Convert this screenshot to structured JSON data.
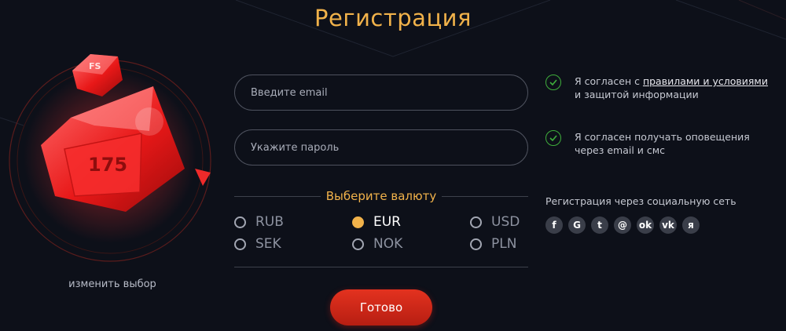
{
  "header": {
    "title": "Регистрация"
  },
  "bonus": {
    "badge": "FS",
    "value": "175",
    "change_label": "изменить выбор"
  },
  "form": {
    "email_placeholder": "Введите email",
    "password_placeholder": "Укажите пароль",
    "currency_title": "Выберите валюту",
    "currencies": [
      {
        "code": "RUB",
        "selected": false
      },
      {
        "code": "EUR",
        "selected": true
      },
      {
        "code": "USD",
        "selected": false
      },
      {
        "code": "SEK",
        "selected": false
      },
      {
        "code": "NOK",
        "selected": false
      },
      {
        "code": "PLN",
        "selected": false
      }
    ],
    "submit_label": "Готово"
  },
  "agreements": {
    "rules_prefix": "Я согласен с ",
    "rules_link": "правилами и условиями",
    "rules_suffix": "и защитой информации",
    "notify_line1": "Я согласен получать оповещения",
    "notify_line2": "через email и смс"
  },
  "social": {
    "title": "Регистрация через социальную сеть",
    "networks": [
      {
        "icon": "facebook-icon",
        "glyph": "f"
      },
      {
        "icon": "google-icon",
        "glyph": "G"
      },
      {
        "icon": "twitter-icon",
        "glyph": "t"
      },
      {
        "icon": "mailru-icon",
        "glyph": "@"
      },
      {
        "icon": "odnoklassniki-icon",
        "glyph": "ok"
      },
      {
        "icon": "vk-icon",
        "glyph": "vk"
      },
      {
        "icon": "yandex-icon",
        "glyph": "я"
      }
    ]
  },
  "colors": {
    "accent": "#f1b24a",
    "button": "#d42a1a",
    "check": "#3fae3c",
    "background": "#0d1019"
  }
}
